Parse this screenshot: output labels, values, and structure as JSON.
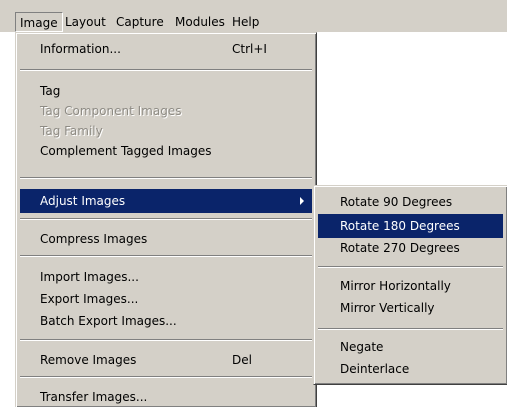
{
  "menubar": {
    "items": [
      {
        "label": "Image"
      },
      {
        "label": "Layout"
      },
      {
        "label": "Capture"
      },
      {
        "label": "Modules"
      },
      {
        "label": "Help"
      }
    ]
  },
  "image_menu": {
    "information": {
      "label": "Information...",
      "shortcut": "Ctrl+I"
    },
    "tag": {
      "label": "Tag"
    },
    "tag_component_images": {
      "label": "Tag Component Images",
      "enabled": false
    },
    "tag_family": {
      "label": "Tag Family",
      "enabled": false
    },
    "complement_tagged_images": {
      "label": "Complement Tagged Images"
    },
    "adjust_images": {
      "label": "Adjust Images",
      "highlighted": true,
      "has_submenu": true
    },
    "compress_images": {
      "label": "Compress Images"
    },
    "import_images": {
      "label": "Import Images..."
    },
    "export_images": {
      "label": "Export  Images..."
    },
    "batch_export_images": {
      "label": "Batch Export Images..."
    },
    "remove_images": {
      "label": "Remove Images",
      "shortcut": "Del"
    },
    "transfer_images": {
      "label": "Transfer Images..."
    }
  },
  "adjust_submenu": {
    "rotate_90": {
      "label": "Rotate 90 Degrees"
    },
    "rotate_180": {
      "label": "Rotate 180 Degrees",
      "highlighted": true
    },
    "rotate_270": {
      "label": "Rotate 270 Degrees"
    },
    "mirror_horizontally": {
      "label": "Mirror Horizontally"
    },
    "mirror_vertically": {
      "label": "Mirror Vertically"
    },
    "negate": {
      "label": "Negate"
    },
    "deinterlace": {
      "label": "Deinterlace"
    }
  },
  "colors": {
    "menu_background": "#d4d0c8",
    "highlight": "#0a246a",
    "highlight_text": "#ffffff",
    "disabled_text": "#8e8b84"
  }
}
